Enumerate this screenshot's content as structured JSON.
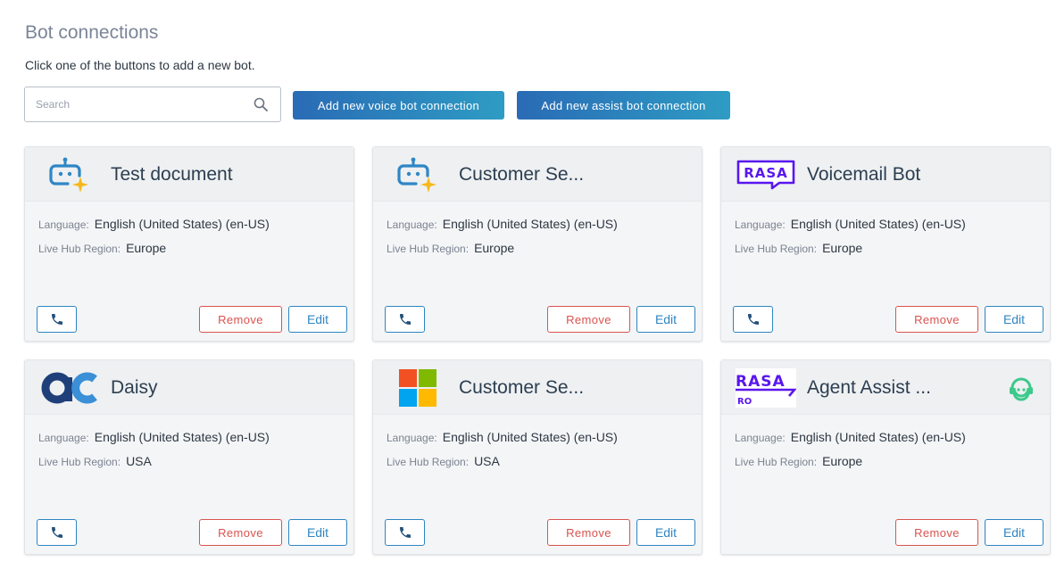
{
  "page": {
    "title": "Bot connections",
    "subtitle": "Click one of the buttons to add a new bot."
  },
  "search": {
    "placeholder": "Search",
    "value": ""
  },
  "actions": {
    "add_voice": "Add new voice bot connection",
    "add_assist": "Add new assist bot connection"
  },
  "labels": {
    "language": "Language:",
    "region": "Live Hub Region:",
    "remove": "Remove",
    "edit": "Edit"
  },
  "logo_texts": {
    "rasa": "RASA",
    "rasa_pro": "RASA",
    "pro": "RO"
  },
  "cards": [
    {
      "title": "Test document",
      "logo": "ai-bot-icon",
      "language": "English (United States) (en-US)",
      "region": "Europe"
    },
    {
      "title": "Customer Se...",
      "logo": "ai-bot-icon",
      "language": "English (United States) (en-US)",
      "region": "Europe"
    },
    {
      "title": "Voicemail Bot",
      "logo": "rasa-logo",
      "language": "English (United States) (en-US)",
      "region": "Europe"
    },
    {
      "title": "Daisy",
      "logo": "ac-logo",
      "language": "English (United States) (en-US)",
      "region": "USA"
    },
    {
      "title": "Customer Se...",
      "logo": "microsoft-logo",
      "language": "English (United States) (en-US)",
      "region": "USA"
    },
    {
      "title": "Agent Assist ...",
      "logo": "rasa-pro-logo",
      "language": "English (United States) (en-US)",
      "region": "Europe",
      "badge": "agent-assist-icon"
    }
  ],
  "colors": {
    "primary_gradient_start": "#2a6bb5",
    "primary_gradient_end": "#2e9cc4",
    "remove": "#d9534f",
    "edit": "#2e86c1",
    "rasa": "#5a17ee",
    "assist_green": "#3cc98a"
  }
}
